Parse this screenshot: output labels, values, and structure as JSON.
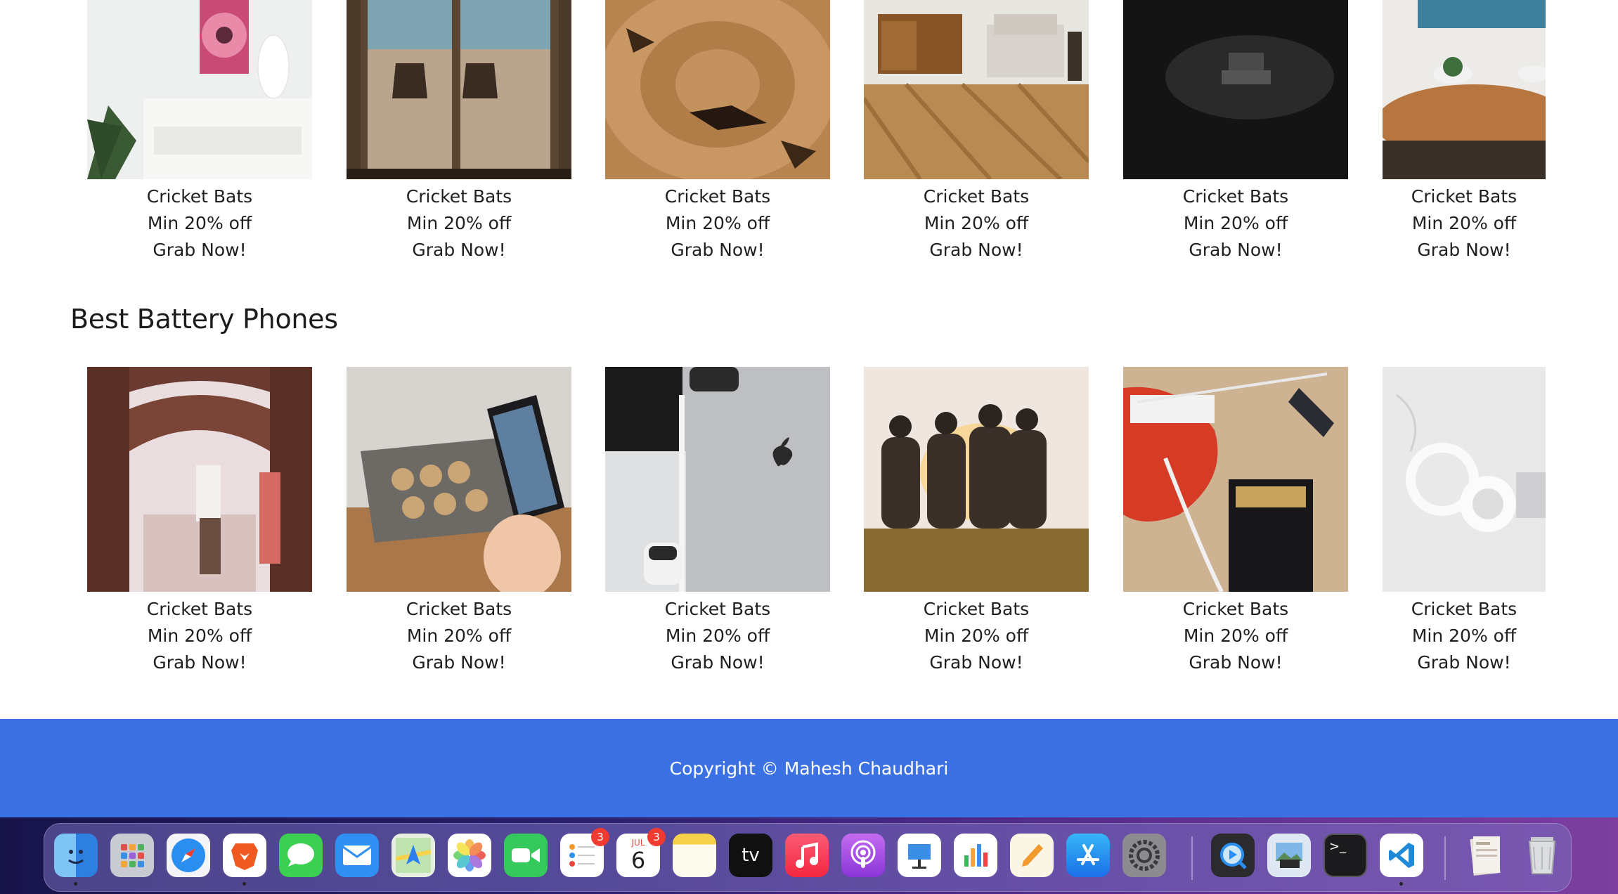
{
  "rows": {
    "top": {
      "items": [
        {
          "title": "Cricket Bats",
          "offer": "Min 20% off",
          "cta": "Grab Now!"
        },
        {
          "title": "Cricket Bats",
          "offer": "Min 20% off",
          "cta": "Grab Now!"
        },
        {
          "title": "Cricket Bats",
          "offer": "Min 20% off",
          "cta": "Grab Now!"
        },
        {
          "title": "Cricket Bats",
          "offer": "Min 20% off",
          "cta": "Grab Now!"
        },
        {
          "title": "Cricket Bats",
          "offer": "Min 20% off",
          "cta": "Grab Now!"
        },
        {
          "title": "Cricket Bats",
          "offer": "Min 20% off",
          "cta": "Grab Now!"
        }
      ]
    },
    "bottom": {
      "title": "Best Battery Phones",
      "items": [
        {
          "title": "Cricket Bats",
          "offer": "Min 20% off",
          "cta": "Grab Now!"
        },
        {
          "title": "Cricket Bats",
          "offer": "Min 20% off",
          "cta": "Grab Now!"
        },
        {
          "title": "Cricket Bats",
          "offer": "Min 20% off",
          "cta": "Grab Now!"
        },
        {
          "title": "Cricket Bats",
          "offer": "Min 20% off",
          "cta": "Grab Now!"
        },
        {
          "title": "Cricket Bats",
          "offer": "Min 20% off",
          "cta": "Grab Now!"
        },
        {
          "title": "Cricket Bats",
          "offer": "Min 20% off",
          "cta": "Grab Now!"
        }
      ]
    }
  },
  "footer": {
    "text": "Copyright © Mahesh Chaudhari",
    "color": "#3b71e3"
  },
  "dock": {
    "apps": [
      {
        "name": "finder-icon"
      },
      {
        "name": "launchpad-icon"
      },
      {
        "name": "safari-icon"
      },
      {
        "name": "brave-icon"
      },
      {
        "name": "messages-icon"
      },
      {
        "name": "mail-icon"
      },
      {
        "name": "maps-icon"
      },
      {
        "name": "photos-icon"
      },
      {
        "name": "facetime-icon"
      },
      {
        "name": "reminders-icon",
        "badge": "3"
      },
      {
        "name": "calendar-icon",
        "badge": "3",
        "month": "JUL",
        "day": "6"
      },
      {
        "name": "notes-icon"
      },
      {
        "name": "apple-tv-icon",
        "label": "tv"
      },
      {
        "name": "music-icon"
      },
      {
        "name": "podcasts-icon"
      },
      {
        "name": "keynote-icon"
      },
      {
        "name": "numbers-icon"
      },
      {
        "name": "pages-icon"
      },
      {
        "name": "app-store-icon"
      },
      {
        "name": "system-preferences-icon"
      },
      {
        "name": "quicktime-icon"
      },
      {
        "name": "preview-icon"
      },
      {
        "name": "terminal-icon",
        "label": ">_"
      },
      {
        "name": "vscode-icon"
      },
      {
        "name": "documents-stack-icon"
      },
      {
        "name": "trash-icon"
      }
    ]
  }
}
